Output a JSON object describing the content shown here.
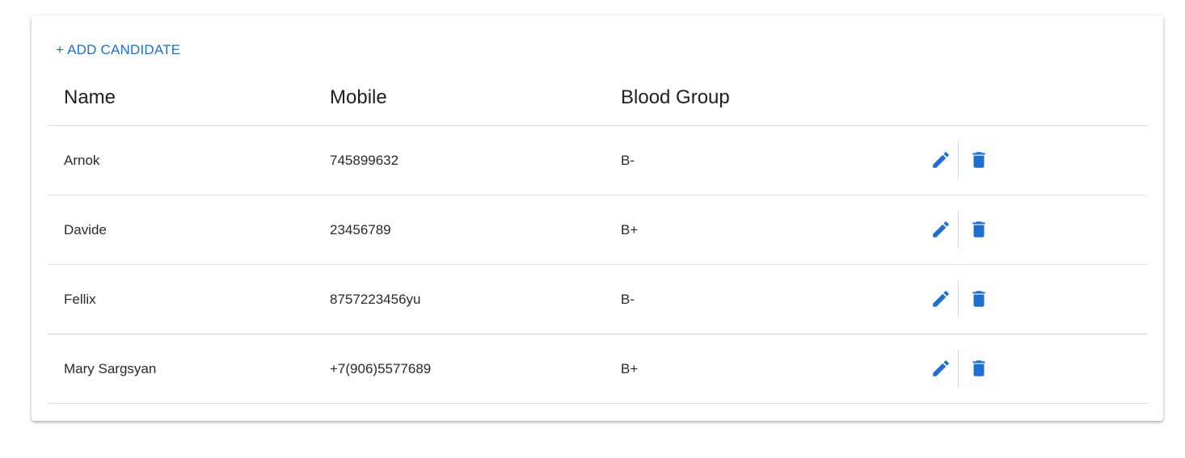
{
  "toolbar": {
    "add_label": "+ ADD CANDIDATE"
  },
  "table": {
    "columns": [
      "Name",
      "Mobile",
      "Blood Group"
    ],
    "rows": [
      {
        "name": "Arnok",
        "mobile": "745899632",
        "blood_group": "B-"
      },
      {
        "name": "Davide",
        "mobile": "23456789",
        "blood_group": "B+"
      },
      {
        "name": "Fellix",
        "mobile": "8757223456yu",
        "blood_group": "B-"
      },
      {
        "name": "Mary Sargsyan",
        "mobile": "+7(906)5577689",
        "blood_group": "B+"
      }
    ]
  },
  "icons": {
    "edit": "pencil-icon",
    "delete": "trash-icon"
  },
  "colors": {
    "accent": "#1f6fd0"
  }
}
